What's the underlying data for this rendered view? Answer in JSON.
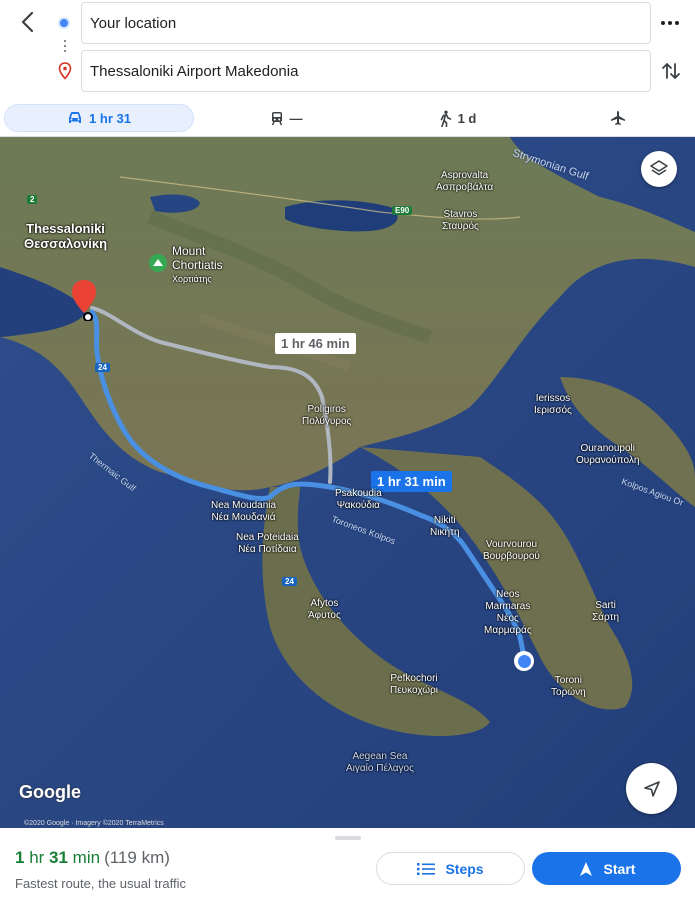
{
  "header": {
    "origin_value": "Your location",
    "destination_value": "Thessaloniki Airport Makedonia"
  },
  "modes": [
    {
      "name": "drive",
      "label": "1 hr 31",
      "selected": true
    },
    {
      "name": "transit",
      "label": "—"
    },
    {
      "name": "walk",
      "label": "1 d"
    },
    {
      "name": "fly",
      "label": ""
    }
  ],
  "map": {
    "labels": {
      "thessaloniki": "Thessaloniki",
      "thessaloniki_gr": "Θεσσαλονίκη",
      "mount": "Mount",
      "chortiatis": "Chortiatis",
      "chortiatis_gr": "Χορτιάτης",
      "asprovalta": "Asprovalta",
      "asprovalta_gr": "Ασπροβάλτα",
      "stavros": "Stavros",
      "stavros_gr": "Σταυρός",
      "poligiros": "Poligiros",
      "poligiros_gr": "Πολύγυρος",
      "ierissos": "Ierissos",
      "ierissos_gr": "Ιερισσός",
      "ouranoupoli": "Ouranoupoli",
      "ouranoupoli_gr": "Ουρανούπολη",
      "nea_moudania": "Nea Moudania",
      "nea_moudania_gr": "Νέα Μουδανιά",
      "psakoudia": "Psakoudia",
      "psakoudia_gr": "Ψακούδια",
      "nikiti": "Nikiti",
      "nikiti_gr": "Νικήτη",
      "nea_poteidaia": "Nea Poteidaia",
      "nea_poteidaia_gr": "Νέα Ποτίδαια",
      "vourvourou": "Vourvourou",
      "vourvourou_gr": "Βουρβουρού",
      "neos_marmaras": "Neos",
      "neos_marmaras_2": "Marmaras",
      "neos_marmaras_gr": "Νέος",
      "neos_marmaras_gr2": "Μαρμαράς",
      "sarti": "Sarti",
      "sarti_gr": "Σάρτη",
      "afytos": "Afytos",
      "afytos_gr": "Άφυτος",
      "pefkochori": "Pefkochori",
      "pefkochori_gr": "Πευκοχώρι",
      "toroni": "Toroni",
      "toroni_gr": "Τορώνη",
      "aegean": "Aegean Sea",
      "aegean_gr": "Αιγαίο Πέλαγος",
      "strymonian": "Strymonian Gulf",
      "thermaic": "Thermaic Gulf",
      "toroneos": "Toroneos Kolpos",
      "kolpos_agiou": "Kolpos Agiou Or"
    },
    "route_times": {
      "alternate": "1 hr 46 min",
      "main": "1 hr 31 min"
    },
    "road_signs": {
      "e90": "E90",
      "r24a": "24",
      "r24b": "24",
      "r2": "2"
    },
    "google": "Google",
    "copyright": "©2020 Google · Imagery ©2020 TerraMetrics"
  },
  "sheet": {
    "eta_hours": "1",
    "eta_hr_unit": " hr ",
    "eta_minutes": "31",
    "eta_min_unit": " min",
    "distance": "(119 km)",
    "subtext": "Fastest route, the usual traffic",
    "steps_label": "Steps",
    "start_label": "Start"
  },
  "colors": {
    "accent": "#1a73e8",
    "eta_green": "#188038",
    "route_main": "#4a90e2",
    "route_alt": "#b0b7c1"
  }
}
